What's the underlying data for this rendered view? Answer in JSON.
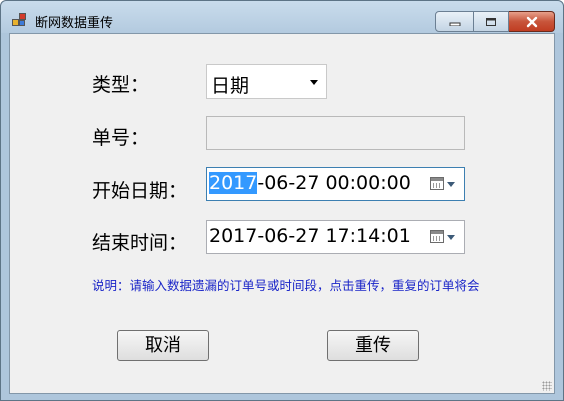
{
  "window": {
    "title": "断网数据重传"
  },
  "form": {
    "type_label": "类型：",
    "type_value": "日期",
    "order_label": "单号：",
    "order_value": "",
    "start_label": "开始日期：",
    "start_value_selected": "2017",
    "start_value_rest": "-06-27 00:00:00",
    "end_label": "结束时间：",
    "end_value": "2017-06-27 17:14:01"
  },
  "note": "说明：请输入数据遗漏的订单号或时间段，点击重传，重复的订单将会",
  "buttons": {
    "cancel": "取消",
    "resend": "重传"
  },
  "colors": {
    "note_text": "#1a25c8",
    "selection": "#3399ff",
    "close_button": "#c8553b"
  },
  "icons": [
    "app-icon",
    "minimize-icon",
    "maximize-icon",
    "close-icon",
    "dropdown-arrow-icon",
    "calendar-icon",
    "resize-grip-icon"
  ]
}
